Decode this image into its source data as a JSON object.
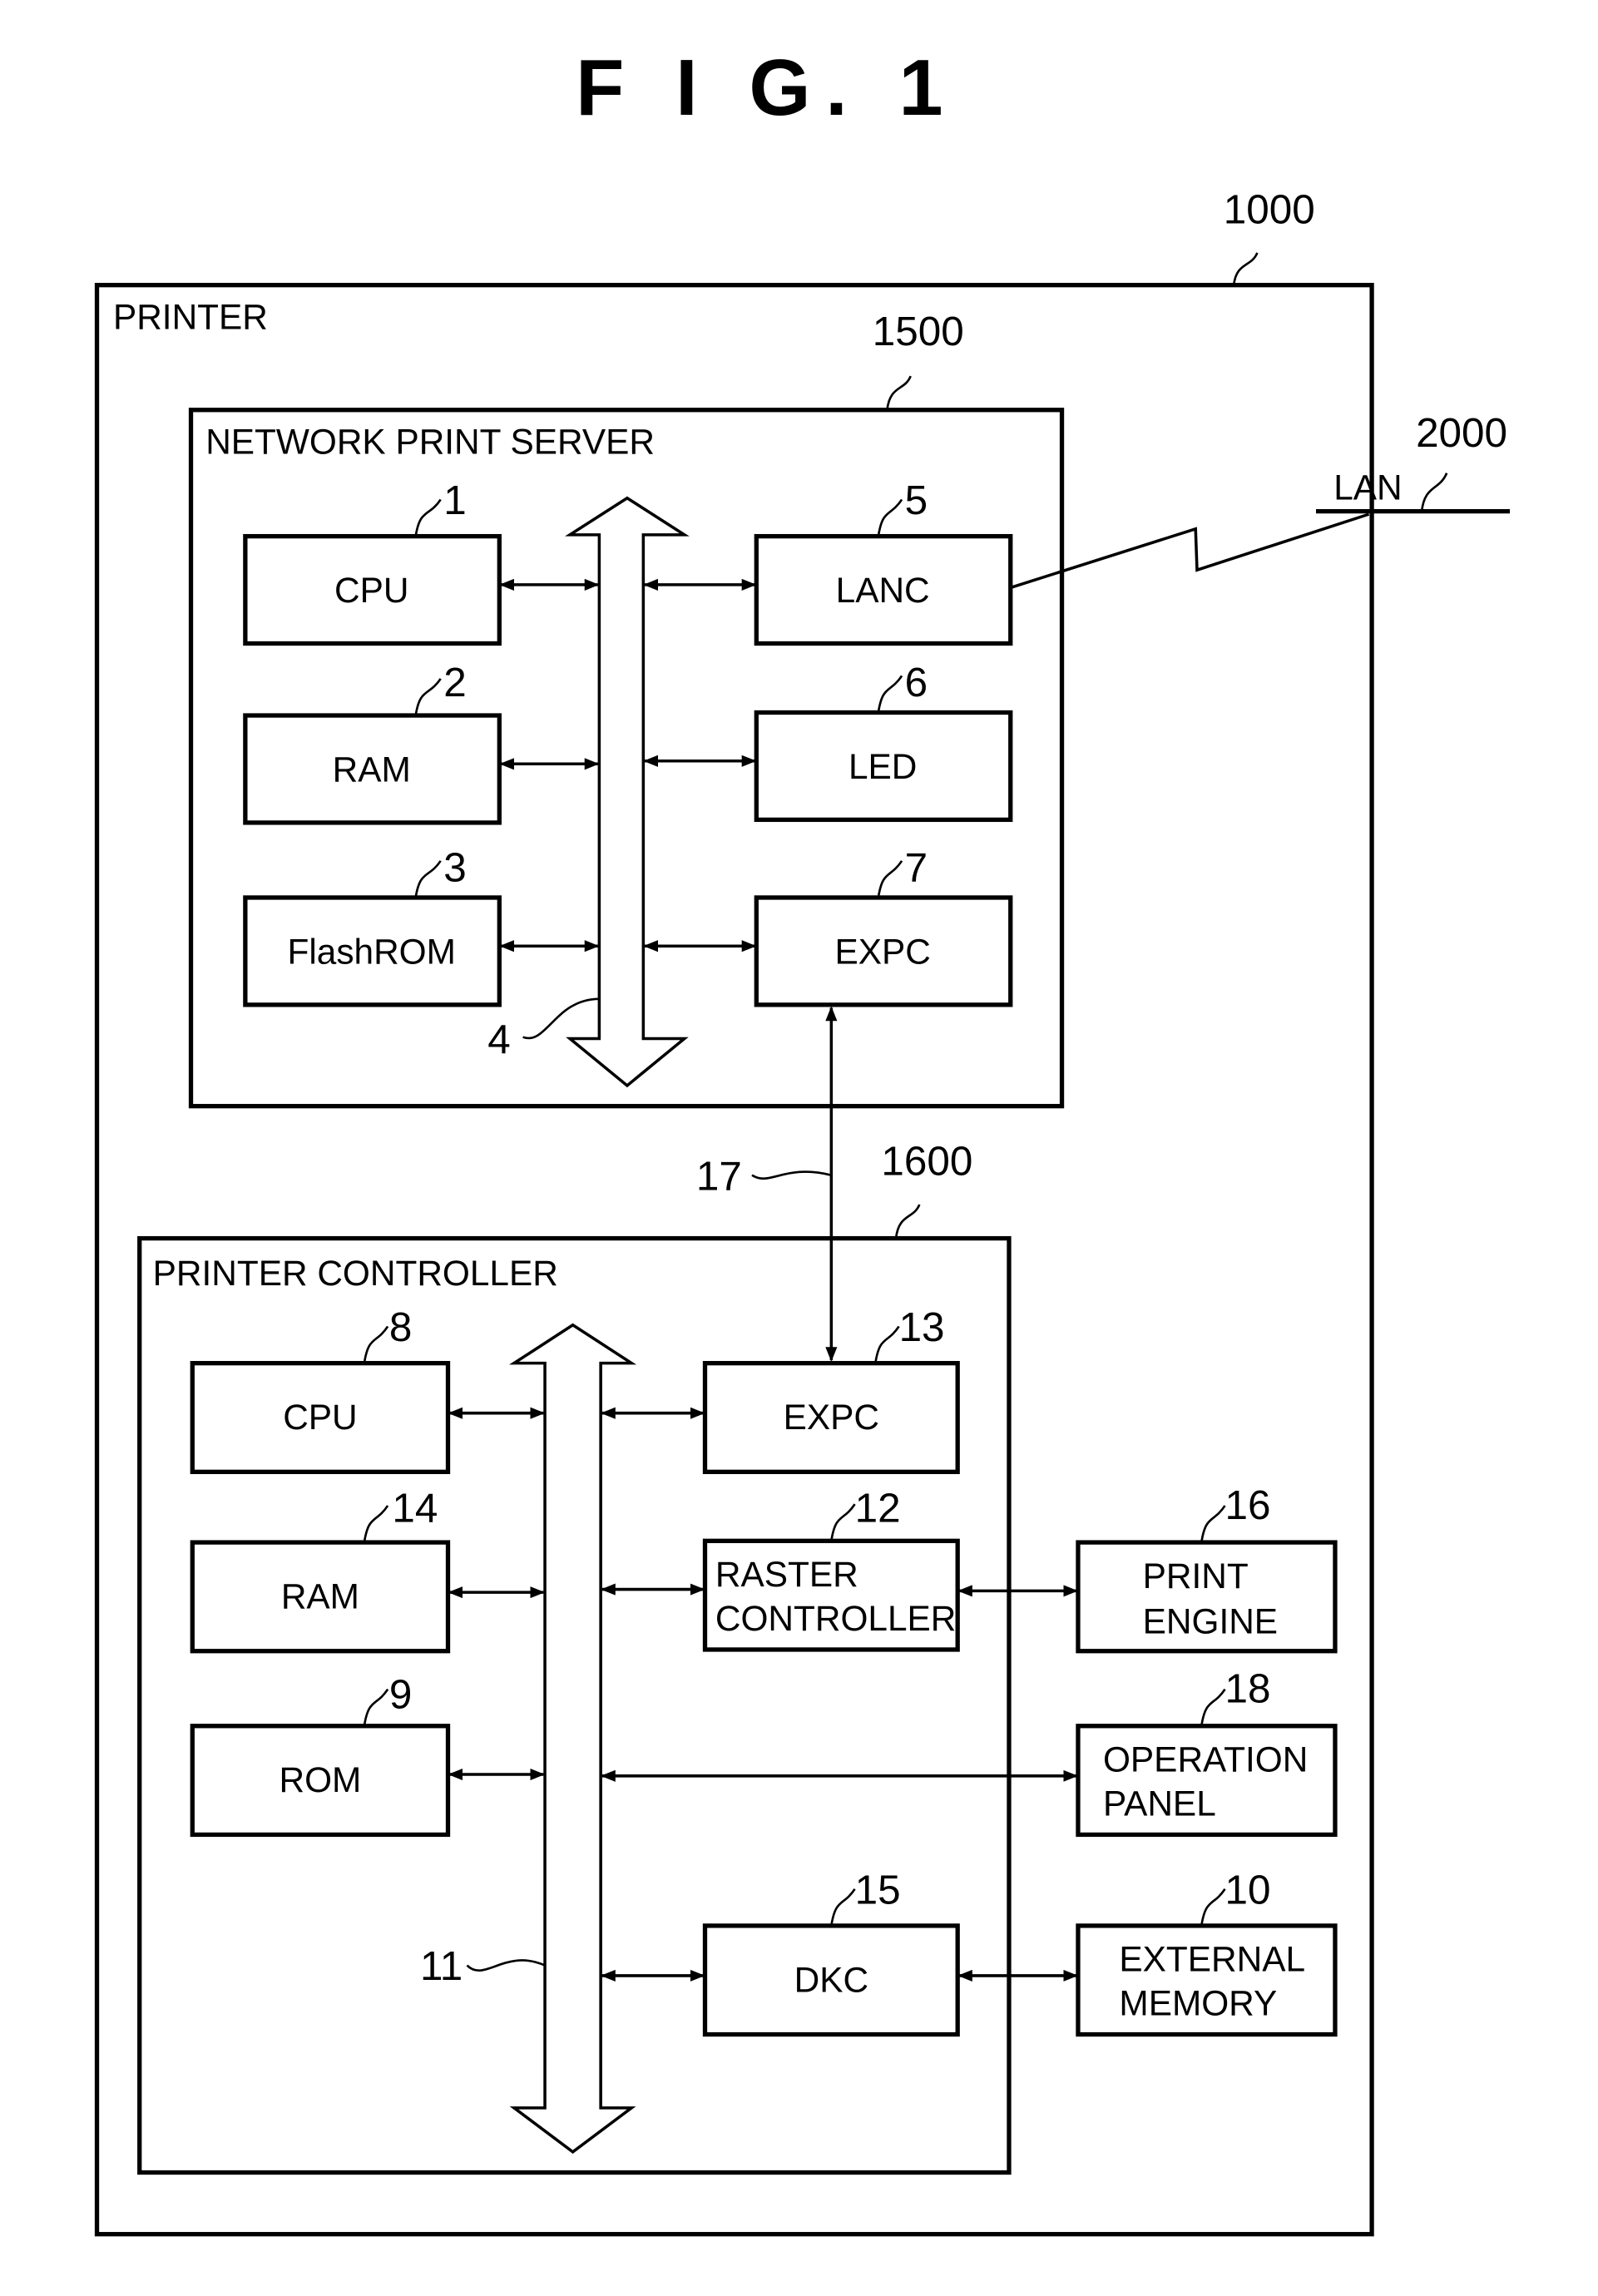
{
  "figure": {
    "title": "F I G.  1",
    "printer": {
      "label": "PRINTER",
      "ref": "1000"
    },
    "lan": {
      "label": "LAN",
      "ref": "2000"
    },
    "network_print_server": {
      "label": "NETWORK  PRINT  SERVER",
      "ref": "1500",
      "bus_ref": "4",
      "blocks": [
        {
          "id": "cpu",
          "label": "CPU",
          "ref": "1"
        },
        {
          "id": "ram",
          "label": "RAM",
          "ref": "2"
        },
        {
          "id": "flashrom",
          "label": "FlashROM",
          "ref": "3"
        },
        {
          "id": "lanc",
          "label": "LANC",
          "ref": "5"
        },
        {
          "id": "led",
          "label": "LED",
          "ref": "6"
        },
        {
          "id": "expc",
          "label": "EXPC",
          "ref": "7"
        }
      ]
    },
    "link_ref": "17",
    "printer_controller": {
      "label": "PRINTER  CONTROLLER",
      "ref": "1600",
      "bus_ref": "11",
      "blocks": [
        {
          "id": "cpu",
          "label": "CPU",
          "ref": "8"
        },
        {
          "id": "ram",
          "label": "RAM",
          "ref": "14"
        },
        {
          "id": "rom",
          "label": "ROM",
          "ref": "9"
        },
        {
          "id": "expc",
          "label": "EXPC",
          "ref": "13"
        },
        {
          "id": "raster",
          "label_line1": "RASTER",
          "label_line2": "CONTROLLER",
          "ref": "12"
        },
        {
          "id": "dkc",
          "label": "DKC",
          "ref": "15"
        }
      ]
    },
    "external": [
      {
        "id": "print-engine",
        "label_line1": "PRINT",
        "label_line2": "ENGINE",
        "ref": "16"
      },
      {
        "id": "operation-panel",
        "label_line1": "OPERATION",
        "label_line2": "PANEL",
        "ref": "18"
      },
      {
        "id": "external-memory",
        "label_line1": "EXTERNAL",
        "label_line2": "MEMORY",
        "ref": "10"
      }
    ]
  }
}
